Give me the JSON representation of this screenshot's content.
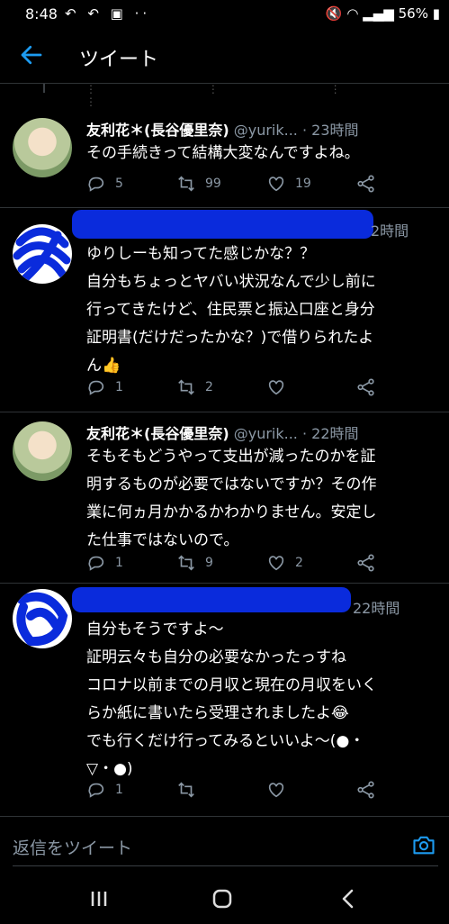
{
  "status": {
    "time": "8:48",
    "left_icons": "↶ ↶ ▣ ··",
    "battery": "56%"
  },
  "header": {
    "title": "ツイート"
  },
  "tweets": [
    {
      "name": "友利花＊(長谷優里奈)",
      "handle": "@yurik...",
      "time": "· 23時間",
      "lines": [
        "その手続きって結構大変なんですよね。"
      ],
      "replies": "5",
      "retweets": "99",
      "likes": "19"
    },
    {
      "time": "2時間",
      "lines": [
        "ゆりしーも知ってた感じかな？？",
        "自分もちょっとヤバい状況なんで少し前に",
        "行ってきたけど、住民票と振込口座と身分",
        "証明書(だけだったかな？)で借りられたよ",
        "ん👍"
      ],
      "replies": "1",
      "retweets": "2",
      "likes": ""
    },
    {
      "name": "友利花＊(長谷優里奈)",
      "handle": "@yurik...",
      "time": "· 22時間",
      "lines": [
        "そもそもどうやって支出が減ったのかを証",
        "明するものが必要ではないですか？その作",
        "業に何ヵ月かかるかわかりません。安定し",
        "た仕事ではないので。"
      ],
      "replies": "1",
      "retweets": "9",
      "likes": "2"
    },
    {
      "time": "22時間",
      "lines": [
        "自分もそうですよ～",
        "証明云々も自分の必要なかったっすね",
        "コロナ以前までの月収と現在の月収をいく",
        "らか紙に書いたら受理されましたよ😂",
        "でも行くだけ行ってみるといいよ～(●・",
        "▽・●)"
      ],
      "replies": "1",
      "retweets": "",
      "likes": ""
    }
  ],
  "compose": {
    "placeholder": "返信をツイート"
  },
  "colors": {
    "accent": "#1d9bf0",
    "redaction": "#0a2bdc"
  }
}
